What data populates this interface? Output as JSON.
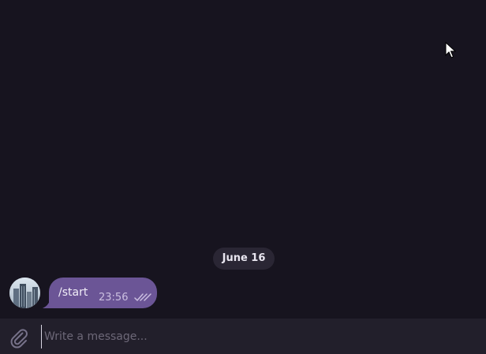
{
  "chat": {
    "date_separator": "June 16",
    "messages": [
      {
        "text": "/start",
        "time": "23:56",
        "status": "read"
      }
    ]
  },
  "composer": {
    "placeholder": "Write a message..."
  },
  "colors": {
    "background": "#17141f",
    "bubble": "#6b5596",
    "date_pill": "#2a2634",
    "composer_bg": "#221f2b"
  },
  "icons": {
    "attach": "paperclip-icon",
    "read_status": "double-check-icon",
    "pointer": "mouse-cursor-icon"
  }
}
